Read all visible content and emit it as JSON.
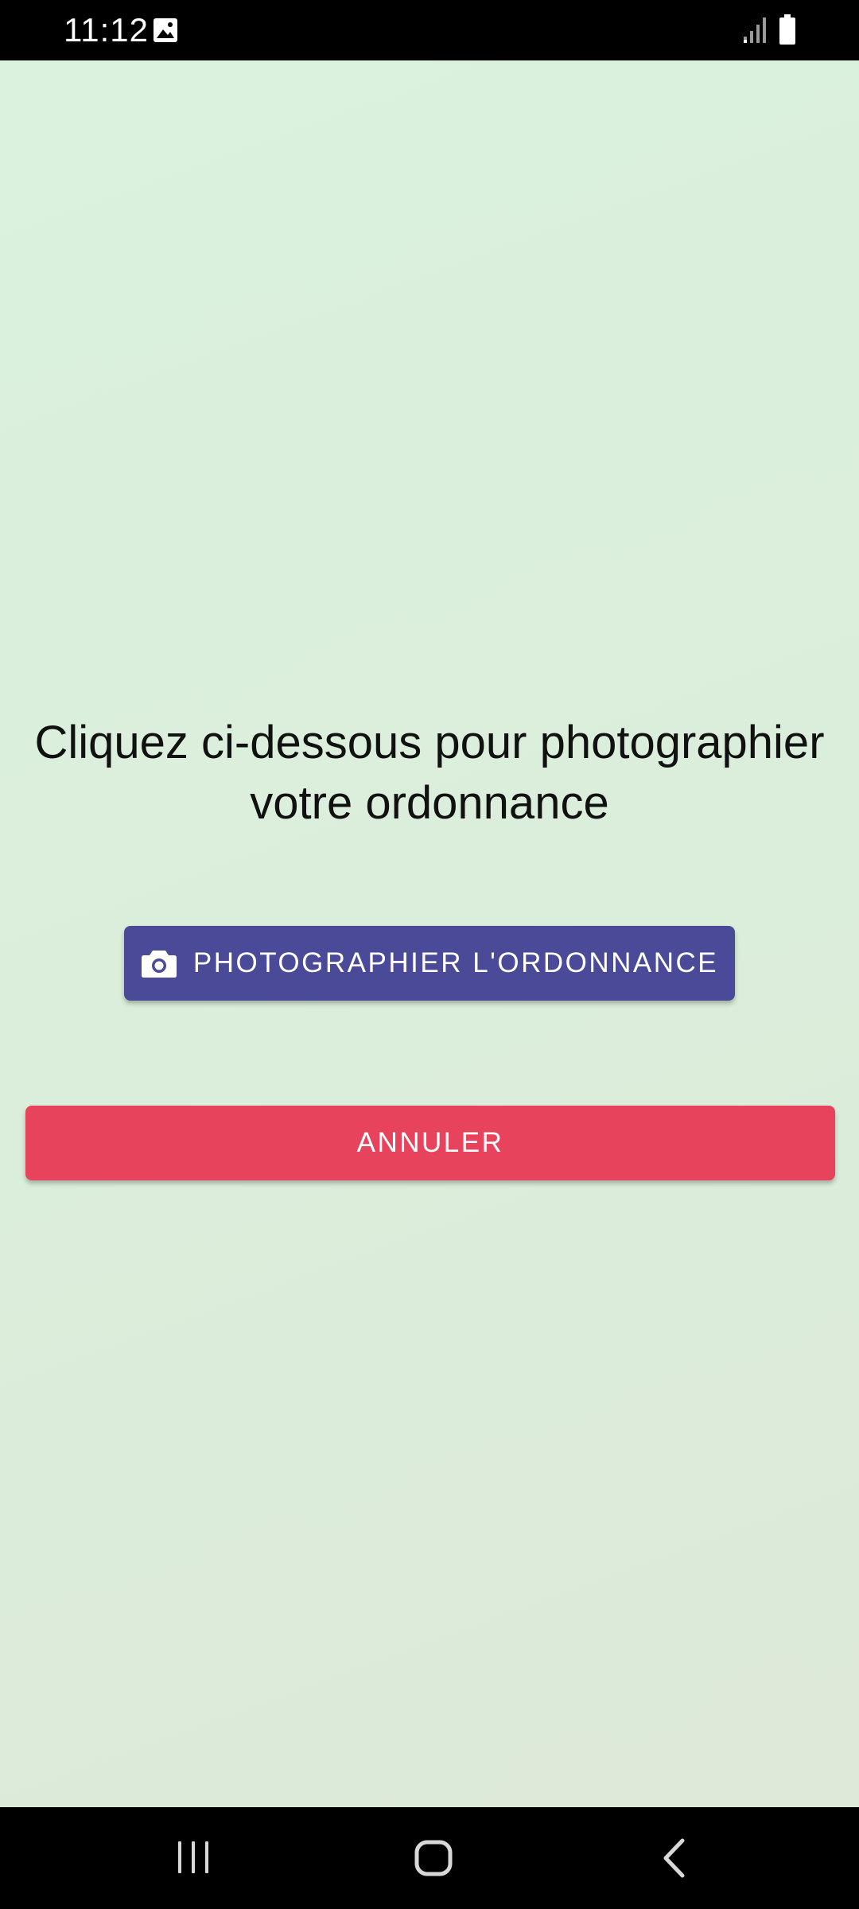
{
  "status_bar": {
    "time": "11:12",
    "icons": [
      "image-notification-icon",
      "signal-icon",
      "battery-icon"
    ]
  },
  "main": {
    "instruction": "Cliquez ci-dessous pour photographier votre ordonnance",
    "photo_button": {
      "label": "PHOTOGRAPHIER L'ORDONNANCE",
      "icon": "camera-icon",
      "color": "#4a4a98"
    },
    "cancel_button": {
      "label": "ANNULER",
      "color": "#e8435c"
    },
    "background_color": "#dbefdc"
  },
  "nav_bar": {
    "icons": [
      "recents-icon",
      "home-icon",
      "back-icon"
    ]
  }
}
